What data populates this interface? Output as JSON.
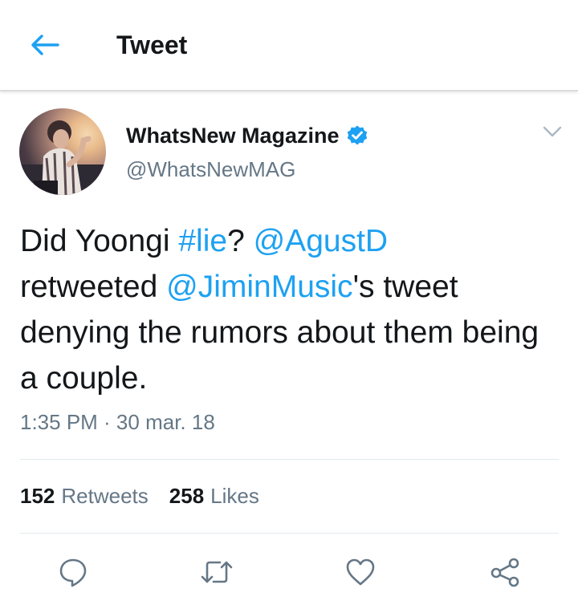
{
  "header": {
    "title": "Tweet",
    "back_icon": "arrow-left-icon"
  },
  "colors": {
    "accent": "#1da1f2",
    "text": "#14171a",
    "muted": "#657786",
    "divider": "#e1e8ed"
  },
  "tweet": {
    "author": {
      "name": "WhatsNew Magazine",
      "handle": "@WhatsNewMAG",
      "verified": true
    },
    "text_parts": [
      "Did Yoongi ",
      "#lie",
      "? ",
      "@AgustD",
      "retweeted ",
      "@JiminMusic",
      "'s tweet denying the rumors about them being a couple."
    ],
    "timestamp": "1:35 PM · 30 mar. 18",
    "stats": {
      "retweets_count": "152",
      "retweets_label": "Retweets",
      "likes_count": "258",
      "likes_label": "Likes"
    },
    "actions": [
      "reply-icon",
      "retweet-icon",
      "like-icon",
      "share-icon"
    ]
  }
}
